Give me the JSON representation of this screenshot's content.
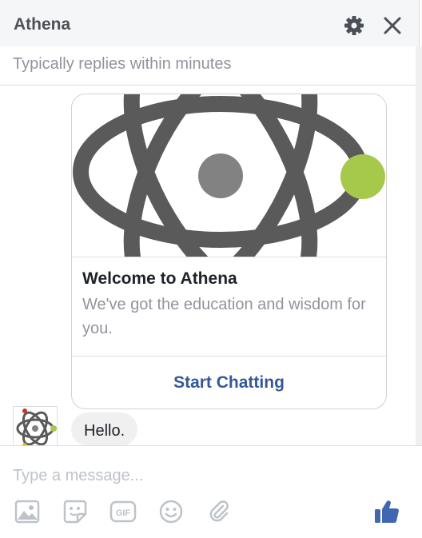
{
  "header": {
    "title": "Athena",
    "icons": [
      "gear-icon",
      "close-icon"
    ]
  },
  "subheader": {
    "status": "Typically replies within minutes"
  },
  "card": {
    "title": "Welcome to Athena",
    "description": "We've got the education and wisdom for you.",
    "button_label": "Start Chatting",
    "image_icon": "atom-logo"
  },
  "messages": [
    {
      "text": "Hello."
    }
  ],
  "composer": {
    "placeholder": "Type a message...",
    "tools": [
      "image-icon",
      "sticker-icon",
      "gif-icon",
      "emoji-icon",
      "attachment-icon"
    ],
    "gif_label": "GIF",
    "send_icon": "thumbs-up-icon"
  },
  "colors": {
    "accent": "#4267b2",
    "button_text": "#365899",
    "logo_gray": "#5a5a5a",
    "logo_dot": "#828282",
    "logo_green": "#a6c84b"
  }
}
